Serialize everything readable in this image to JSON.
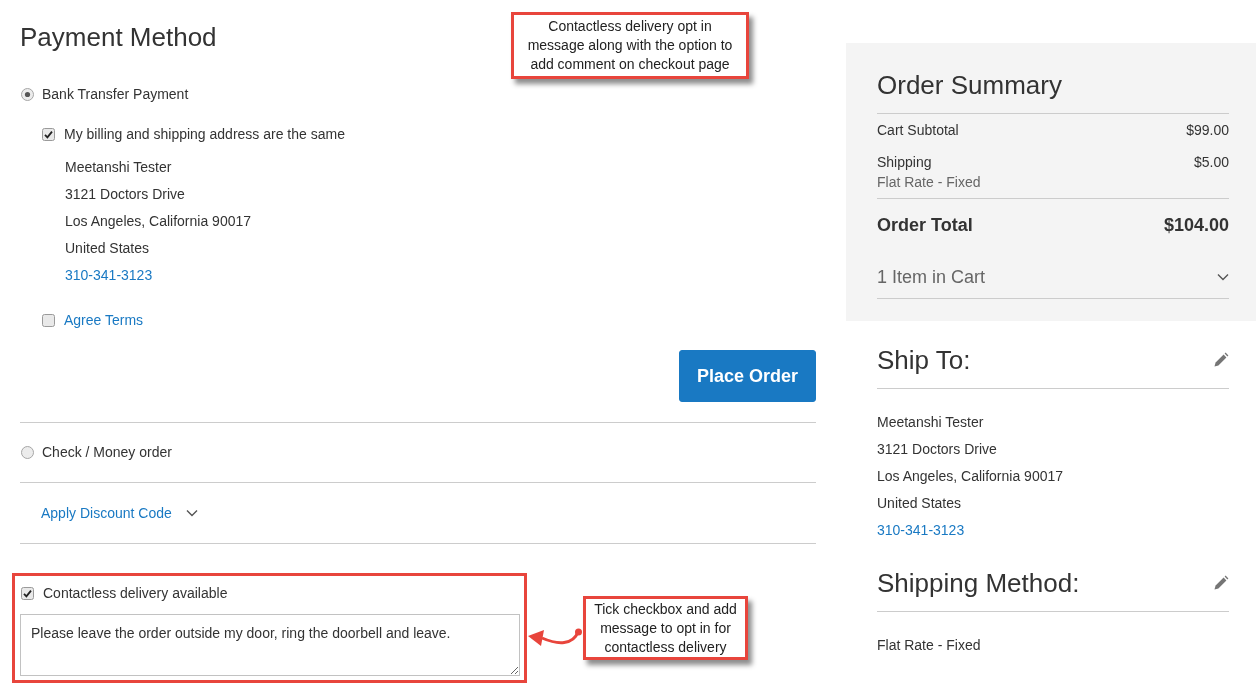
{
  "payment_method": {
    "title": "Payment Method",
    "options": [
      {
        "label": "Bank Transfer Payment",
        "selected": true,
        "billing_same": {
          "label": "My billing and shipping address are the same",
          "checked": true
        },
        "address": [
          "Meetanshi Tester",
          "3121 Doctors Drive",
          "Los Angeles, California 90017",
          "United States"
        ],
        "phone": "310-341-3123",
        "agree_terms": {
          "label": "Agree Terms",
          "checked": false
        },
        "button": "Place Order"
      },
      {
        "label": "Check / Money order",
        "selected": false
      }
    ]
  },
  "discount": {
    "label": "Apply Discount Code",
    "expanded": false
  },
  "contactless": {
    "label": "Contactless delivery available",
    "checked": true,
    "comment": "Please leave the order outside my door, ring the doorbell and leave.",
    "highlighted": true
  },
  "order_summary": {
    "title": "Order Summary",
    "rows": [
      {
        "label": "Cart Subtotal",
        "value": "$99.00"
      },
      {
        "label": "Shipping",
        "sublabel": "Flat Rate - Fixed",
        "value": "$5.00"
      }
    ],
    "total": {
      "label": "Order Total",
      "value": "$104.00"
    },
    "items_toggle": {
      "label": "1 Item in Cart",
      "expanded": false
    }
  },
  "ship_to": {
    "title": "Ship To:",
    "address": [
      "Meetanshi Tester",
      "3121 Doctors Drive",
      "Los Angeles, California 90017",
      "United States"
    ],
    "phone": "310-341-3123"
  },
  "shipping_method": {
    "title": "Shipping Method:",
    "value": "Flat Rate - Fixed"
  },
  "annotations": [
    {
      "kind": "callout",
      "text": "Contactless delivery opt in message along with the option to add comment on checkout page"
    },
    {
      "kind": "arrow_callout",
      "text": "Tick checkbox and add message to opt in for contactless delivery"
    }
  ]
}
